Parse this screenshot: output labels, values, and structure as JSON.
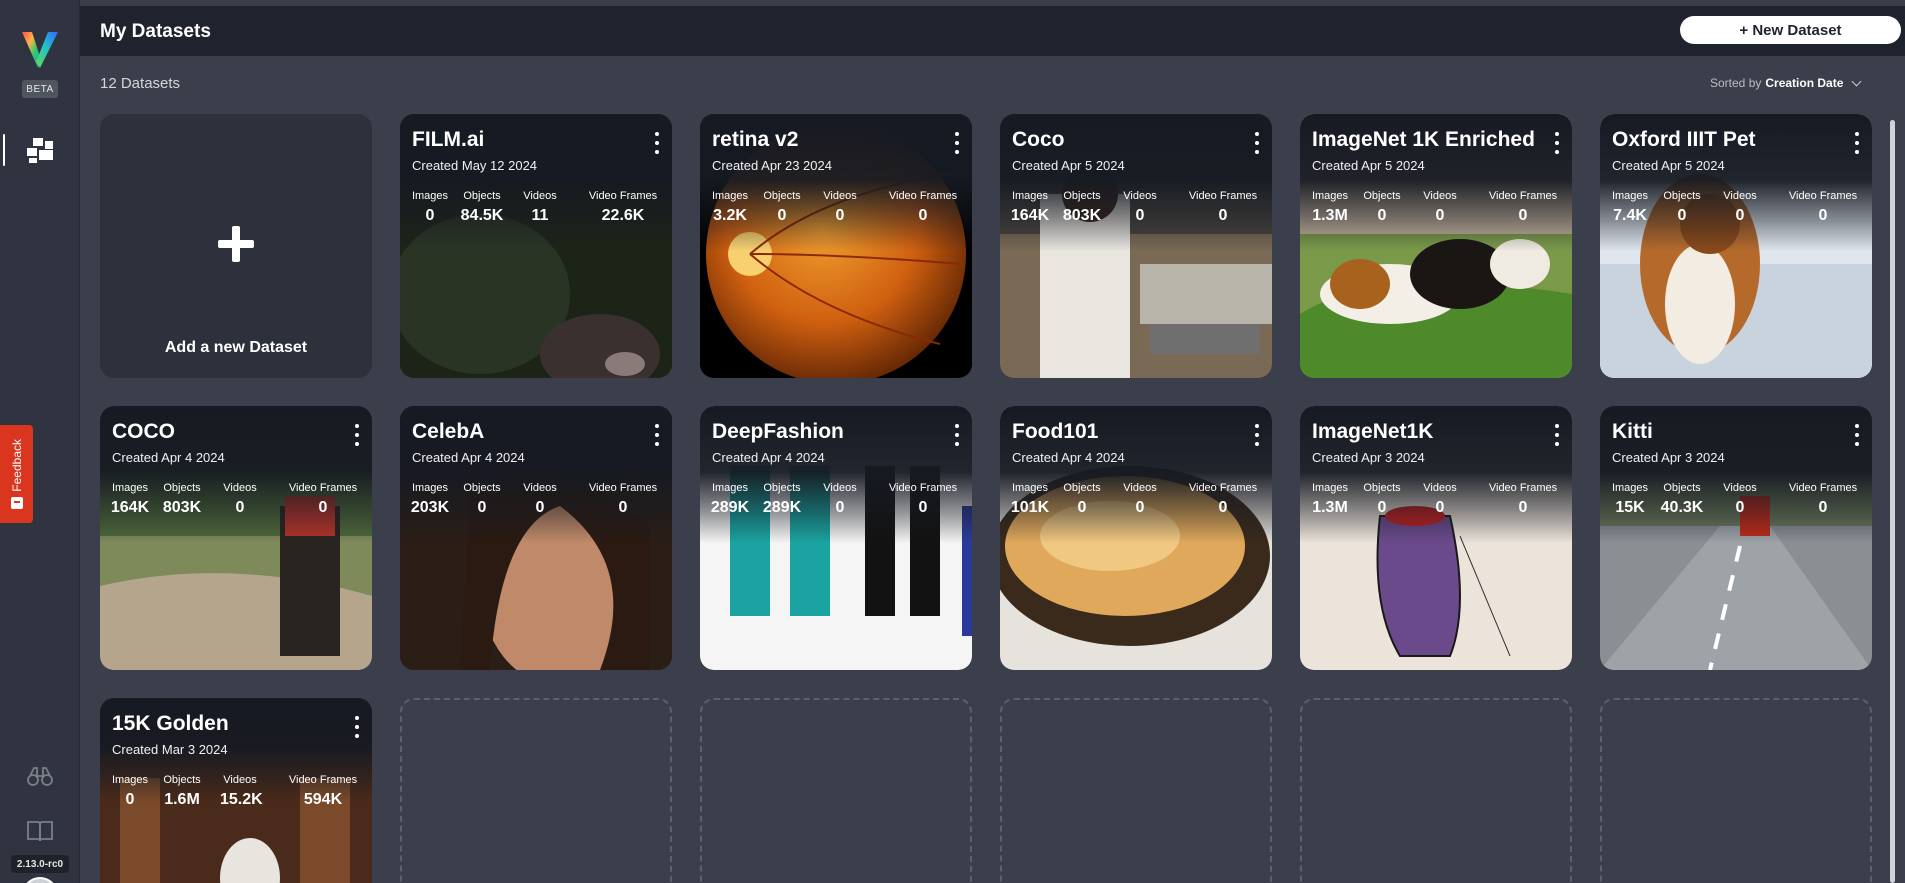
{
  "sidebar": {
    "beta_label": "BETA",
    "version": "2.13.0-rc0",
    "feedback_label": "Feedback"
  },
  "header": {
    "title": "My Datasets",
    "new_dataset_label": "+ New Dataset"
  },
  "subheader": {
    "count": "12 Datasets",
    "sorted_by_label": "Sorted by",
    "sort_value": "Creation Date"
  },
  "add_card": {
    "label": "Add a new Dataset"
  },
  "stat_labels": {
    "images": "Images",
    "objects": "Objects",
    "videos": "Videos",
    "frames": "Video Frames"
  },
  "datasets": [
    {
      "name": "FILM.ai",
      "created": "Created May 12 2024",
      "images": "0",
      "objects": "84.5K",
      "videos": "11",
      "frames": "22.6K"
    },
    {
      "name": "retina v2",
      "created": "Created Apr 23 2024",
      "images": "3.2K",
      "objects": "0",
      "videos": "0",
      "frames": "0"
    },
    {
      "name": "Coco",
      "created": "Created Apr 5 2024",
      "images": "164K",
      "objects": "803K",
      "videos": "0",
      "frames": "0"
    },
    {
      "name": "ImageNet 1K Enriched",
      "created": "Created Apr 5 2024",
      "images": "1.3M",
      "objects": "0",
      "videos": "0",
      "frames": "0"
    },
    {
      "name": "Oxford IIIT Pet",
      "created": "Created Apr 5 2024",
      "images": "7.4K",
      "objects": "0",
      "videos": "0",
      "frames": "0"
    },
    {
      "name": "COCO",
      "created": "Created Apr 4 2024",
      "images": "164K",
      "objects": "803K",
      "videos": "0",
      "frames": "0"
    },
    {
      "name": "CelebA",
      "created": "Created Apr 4 2024",
      "images": "203K",
      "objects": "0",
      "videos": "0",
      "frames": "0"
    },
    {
      "name": "DeepFashion",
      "created": "Created Apr 4 2024",
      "images": "289K",
      "objects": "289K",
      "videos": "0",
      "frames": "0"
    },
    {
      "name": "Food101",
      "created": "Created Apr 4 2024",
      "images": "101K",
      "objects": "0",
      "videos": "0",
      "frames": "0"
    },
    {
      "name": "ImageNet1K",
      "created": "Created Apr 3 2024",
      "images": "1.3M",
      "objects": "0",
      "videos": "0",
      "frames": "0"
    },
    {
      "name": "Kitti",
      "created": "Created Apr 3 2024",
      "images": "15K",
      "objects": "40.3K",
      "videos": "0",
      "frames": "0"
    },
    {
      "name": "15K Golden",
      "created": "Created Mar 3 2024",
      "images": "0",
      "objects": "1.6M",
      "videos": "15.2K",
      "frames": "594K"
    }
  ],
  "colors": {
    "background": "#3a3f4b",
    "topbar": "#1f232d",
    "sidebar": "#2f3440",
    "feedback": "#d9351f"
  }
}
